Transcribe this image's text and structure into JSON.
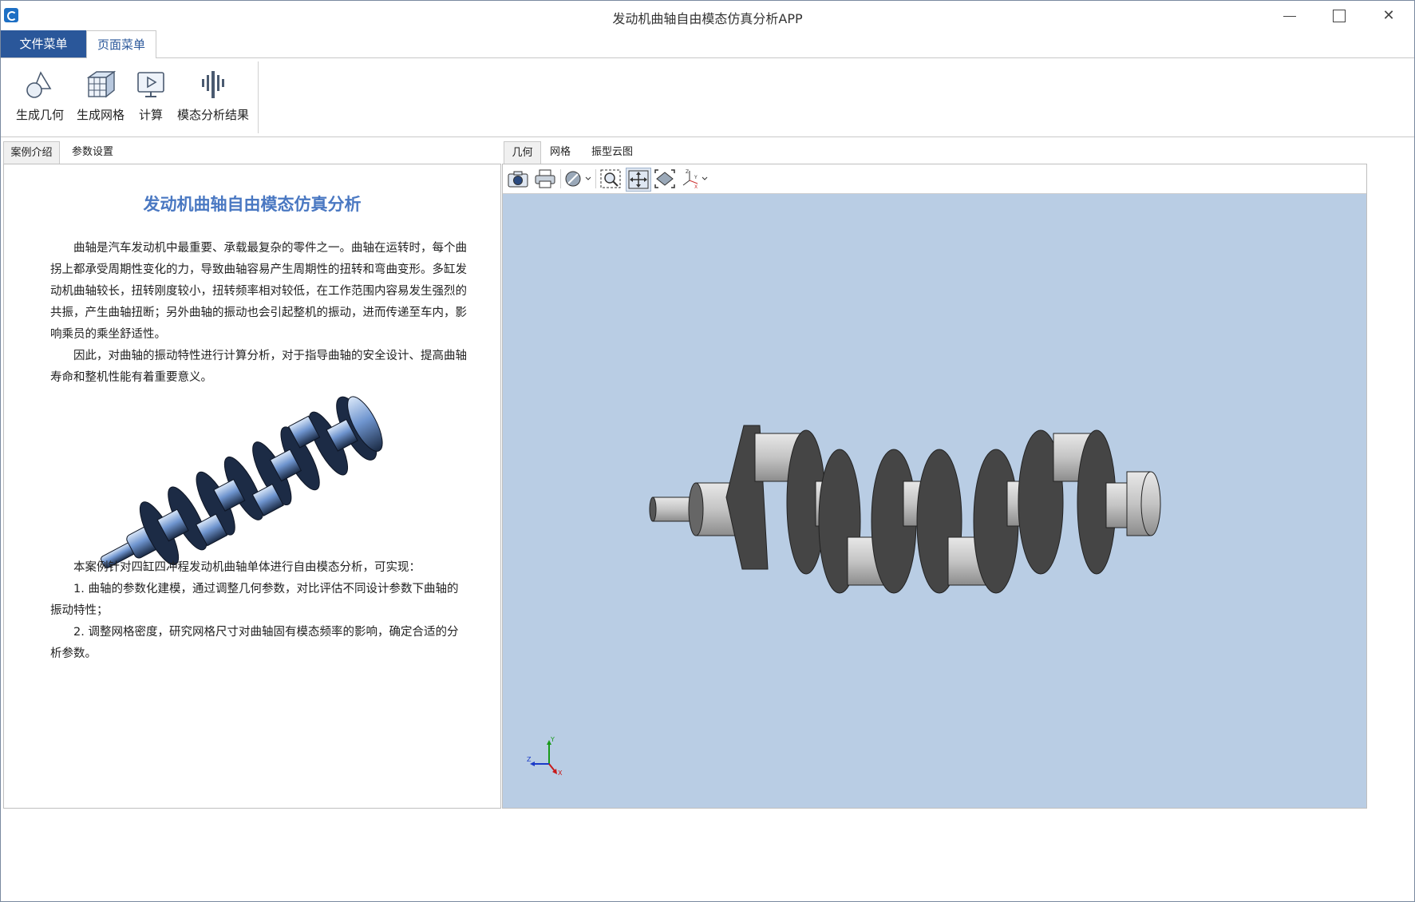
{
  "window": {
    "title": "发动机曲轴自由模态仿真分析APP"
  },
  "menu": {
    "file_label": "文件菜单",
    "page_label": "页面菜单"
  },
  "ribbon": {
    "buttons": [
      {
        "label": "生成几何",
        "icon": "geometry-icon"
      },
      {
        "label": "生成网格",
        "icon": "mesh-cube-icon"
      },
      {
        "label": "计算",
        "icon": "compute-monitor-icon"
      },
      {
        "label": "模态分析结果",
        "icon": "modal-result-icon"
      }
    ]
  },
  "left_tabs": {
    "intro": "案例介绍",
    "params": "参数设置"
  },
  "doc": {
    "title": "发动机曲轴自由模态仿真分析",
    "para1": "曲轴是汽车发动机中最重要、承载最复杂的零件之一。曲轴在运转时，每个曲拐上都承受周期性变化的力，导致曲轴容易产生周期性的扭转和弯曲变形。多缸发动机曲轴较长，扭转刚度较小，扭转频率相对较低，在工作范围内容易发生强烈的共振，产生曲轴扭断；另外曲轴的振动也会引起整机的振动，进而传递至车内，影响乘员的乘坐舒适性。",
    "para2": "因此，对曲轴的振动特性进行计算分析，对于指导曲轴的安全设计、提高曲轴寿命和整机性能有着重要意义。",
    "para3": "本案例针对四缸四冲程发动机曲轴单体进行自由模态分析，可实现：",
    "item1": "1. 曲轴的参数化建模，通过调整几何参数，对比评估不同设计参数下曲轴的振动特性；",
    "item2": "2. 调整网格密度，研究网格尺寸对曲轴固有模态频率的影响，确定合适的分析参数。"
  },
  "right_tabs": {
    "geometry": "几何",
    "mesh": "网格",
    "mode_shape": "振型云图"
  },
  "viewer": {
    "background": "#b9cde4",
    "toolbar": [
      "camera-icon",
      "print-icon",
      "display-mode-icon",
      "zoom-box-icon",
      "pan-icon",
      "fit-view-icon",
      "axis-view-icon"
    ],
    "axes": {
      "y": "Y",
      "z": "Z",
      "x": "X"
    }
  },
  "colors": {
    "accent": "#2a579a",
    "title_blue": "#4a78c2"
  }
}
